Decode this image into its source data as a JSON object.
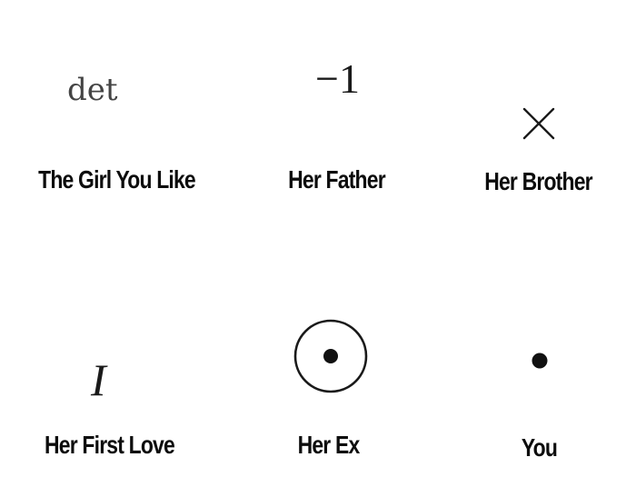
{
  "meme": {
    "cells": [
      {
        "symbol": "det",
        "symbol_icon": "determinant-text",
        "caption": "The Girl You Like"
      },
      {
        "symbol": "−1",
        "symbol_icon": "negative-one-text",
        "caption": "Her Father"
      },
      {
        "symbol": "",
        "symbol_icon": "times-cross-icon",
        "caption": "Her Brother"
      },
      {
        "symbol": "I",
        "symbol_icon": "italic-identity-I",
        "caption": "Her First Love"
      },
      {
        "symbol": "",
        "symbol_icon": "circled-dot-icon",
        "caption": "Her Ex"
      },
      {
        "symbol": "",
        "symbol_icon": "dot-icon",
        "caption": "You"
      }
    ]
  },
  "colors": {
    "background": "#ffffff",
    "ink": "#1a1a1a",
    "det_gray": "#444444"
  }
}
